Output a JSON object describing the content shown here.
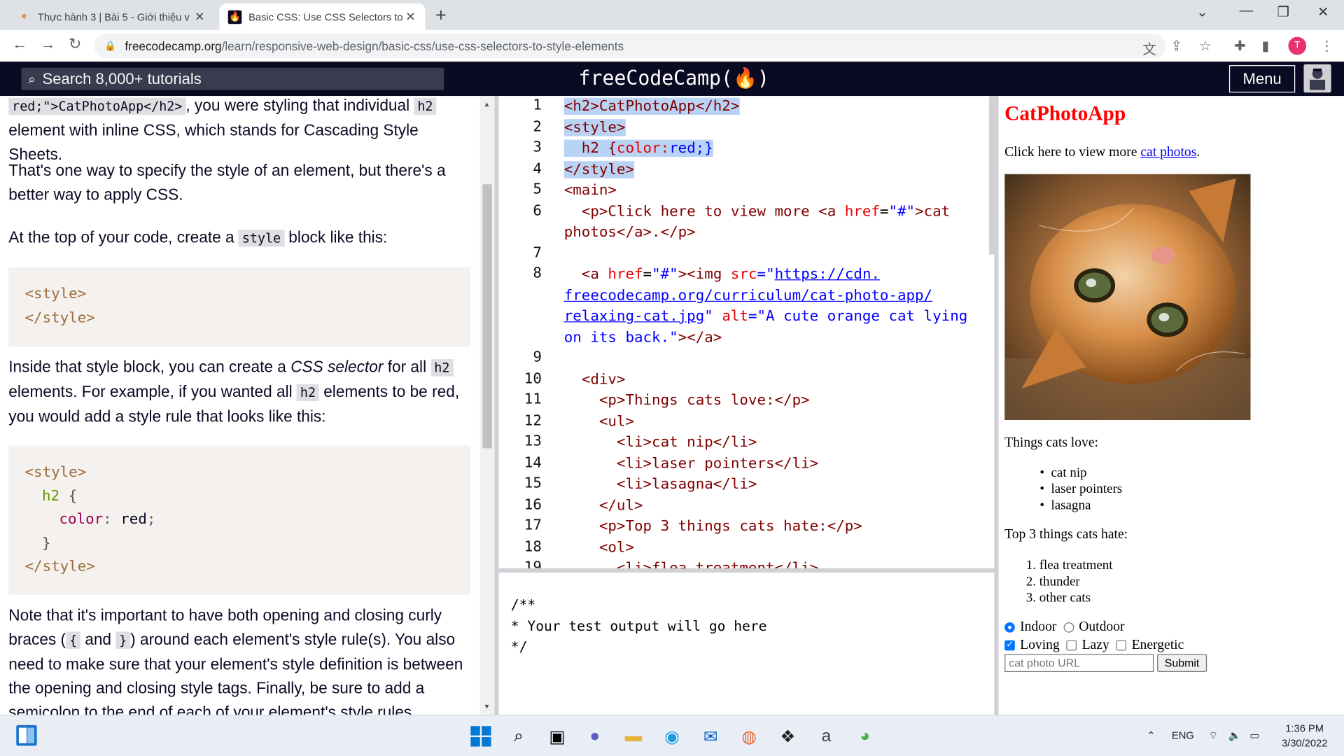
{
  "browser": {
    "tabs": [
      {
        "title": "Thực hành 3 | Bài 5 - Giới thiệu v"
      },
      {
        "title": "Basic CSS: Use CSS Selectors to S"
      }
    ],
    "url_host": "freecodecamp.org",
    "url_path": "/learn/responsive-web-design/basic-css/use-css-selectors-to-style-elements",
    "profile_initial": "T"
  },
  "fcc": {
    "search_placeholder": "Search 8,000+ tutorials",
    "brand": "freeCodeCamp(🔥)",
    "menu_label": "Menu"
  },
  "instructions": {
    "p1_code": "red;\">CatPhotoApp</h2>",
    "p1_a": ", you were styling that individual ",
    "p1_code2": "h2",
    "p1_b": " element with inline CSS, which stands for Cascading Style Sheets.",
    "p2": "That's one way to specify the style of an element, but there's a better way to apply CSS.",
    "p3_a": "At the top of your code, create a ",
    "p3_code": "style",
    "p3_b": " block like this:",
    "code1": [
      "<style>",
      "</style>"
    ],
    "p4_a": "Inside that style block, you can create a ",
    "p4_em": "CSS selector",
    "p4_b": " for all ",
    "p4_code": "h2",
    "p4_c": " elements. For example, if you wanted all ",
    "p4_code2": "h2",
    "p4_d": " elements to be red, you would add a style rule that looks like this:",
    "code2": {
      "open": "<style>",
      "selector": "h2",
      "brace_open": "{",
      "prop": "color",
      "value": "red",
      "brace_close": "}",
      "close": "</style>"
    },
    "p5_a": "Note that it's important to have both opening and closing curly braces (",
    "p5_code1": "{",
    "p5_and": " and ",
    "p5_code2": "}",
    "p5_b": ") around each element's style rule(s). You also need to make sure that your element's style definition is between the opening and closing style tags. Finally, be sure to add a semicolon to the end of each of your element's style rules."
  },
  "editor": {
    "line_numbers": [
      "1",
      "2",
      "3",
      "4",
      "5",
      "6",
      "",
      "7",
      "8",
      "",
      "",
      "",
      "9",
      "10",
      "11",
      "12",
      "13",
      "14",
      "15",
      "16",
      "17",
      "18",
      "19"
    ],
    "l1": "<h2>CatPhotoApp</h2>",
    "l2": "<style>",
    "l3_a": "  h2 {",
    "l3_b": "color:",
    "l3_c": "red;}",
    "l4": "</style>",
    "l5": "<main>",
    "l6_a": "  <p>Click here to view more <a ",
    "l6_b": "href",
    "l6_c": "=",
    "l6_d": "\"#\"",
    "l6_e": ">cat",
    "l6_f": "photos</a>.</p>",
    "l8_a": "  <a ",
    "l8_b": "href",
    "l8_c": "=",
    "l8_d": "\"#\"",
    "l8_e": "><img ",
    "l8_f": "src",
    "l8_g": "=\"",
    "l8_h": "https://cdn.",
    "l8_i": "freecodecamp.org/curriculum/cat-photo-app/",
    "l8_j": "relaxing-cat.jpg",
    "l8_k": "\" ",
    "l8_l": "alt",
    "l8_m": "=\"A cute orange cat lying",
    "l8_n": "on its back.\"",
    "l8_o": "></a>",
    "l10": "  <div>",
    "l11": "    <p>Things cats love:</p>",
    "l12": "    <ul>",
    "l13": "      <li>cat nip</li>",
    "l14": "      <li>laser pointers</li>",
    "l15": "      <li>lasagna</li>",
    "l16": "    </ul>",
    "l17": "    <p>Top 3 things cats hate:</p>",
    "l18": "    <ol>",
    "l19": "      <li>flea treatment</li>"
  },
  "console": {
    "lines": [
      "/**",
      "* Your test output will go here",
      "*/"
    ]
  },
  "preview": {
    "title": "CatPhotoApp",
    "p1_a": "Click here to view more ",
    "p1_link": "cat photos",
    "p1_b": ".",
    "loves_label": "Things cats love:",
    "loves": [
      "cat nip",
      "laser pointers",
      "lasagna"
    ],
    "hates_label": "Top 3 things cats hate:",
    "hates": [
      "flea treatment",
      "thunder",
      "other cats"
    ],
    "radio_indoor": "Indoor",
    "radio_outdoor": "Outdoor",
    "chk_loving": "Loving",
    "chk_lazy": "Lazy",
    "chk_energetic": "Energetic",
    "url_placeholder": "cat photo URL",
    "submit_label": "Submit"
  },
  "taskbar": {
    "lang": "ENG",
    "time": "1:36 PM",
    "date": "3/30/2022"
  },
  "colors": {
    "fcc_nav": "#0a0a23",
    "preview_title": "#ff0000",
    "selection": "#b9d3f4"
  }
}
